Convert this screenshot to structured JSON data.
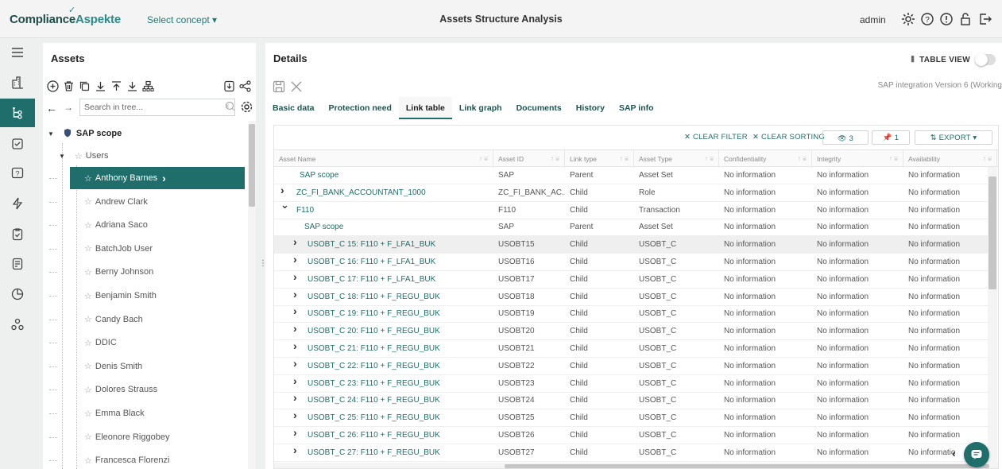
{
  "header": {
    "logo_part1": "Compliance",
    "logo_part2": "Aspekte",
    "concept_label": "Select concept ▾",
    "app_title": "Assets Structure Analysis",
    "user": "admin",
    "icons": [
      "gear-icon",
      "help-icon",
      "info-icon",
      "lock-icon",
      "logout-icon"
    ]
  },
  "leftnav": {
    "items": [
      "menu-icon",
      "building-icon",
      "tree-structure-icon",
      "checklist-icon",
      "question-icon",
      "bolt-icon",
      "clipboard-icon",
      "report-icon",
      "chart-icon",
      "org-icon"
    ],
    "active_index": 2
  },
  "assets": {
    "title": "Assets",
    "search_placeholder": "Search in tree...",
    "tree": {
      "root": "SAP scope",
      "group": "Users",
      "users": [
        "Anthony Barnes",
        "Andrew Clark",
        "Adriana Saco",
        "BatchJob User",
        "Berny Johnson",
        "Benjamin Smith",
        "Candy Bach",
        "DDIC",
        "Denis Smith",
        "Dolores Strauss",
        "Emma Black",
        "Eleonore Riggobey",
        "Francesca Florenzi"
      ],
      "selected": "Anthony Barnes"
    }
  },
  "details": {
    "title": "Details",
    "table_view_label": "TABLE VIEW",
    "version_text": "SAP integration Version 6 (Working",
    "tabs": [
      "Basic data",
      "Protection need",
      "Link table",
      "Link graph",
      "Documents",
      "History",
      "SAP info"
    ],
    "active_tab": "Link table",
    "toolbar": {
      "clear_filter": "CLEAR FILTER",
      "clear_sorting": "CLEAR SORTING",
      "visible_count": "3",
      "pinned_count": "1",
      "export": "EXPORT"
    },
    "columns": [
      "Asset Name",
      "Asset ID",
      "Link type",
      "Asset Type",
      "Confidentiality",
      "Integrity",
      "Availability"
    ],
    "rows": [
      {
        "name": "SAP scope",
        "indent": 1,
        "chev": "",
        "id": "SAP",
        "link": "Parent",
        "type": "Asset Set",
        "conf": "No information",
        "integ": "No information",
        "avail": "No information"
      },
      {
        "name": "ZC_FI_BANK_ACCOUNTANT_1000",
        "indent": 0,
        "chev": ">",
        "id": "ZC_FI_BANK_AC...",
        "link": "Child",
        "type": "Role",
        "conf": "No information",
        "integ": "No information",
        "avail": "No information"
      },
      {
        "name": "F110",
        "indent": 0,
        "chev": "v",
        "id": "F110",
        "link": "Child",
        "type": "Transaction",
        "conf": "No information",
        "integ": "No information",
        "avail": "No information"
      },
      {
        "name": "SAP scope",
        "indent": 2,
        "chev": "",
        "id": "SAP",
        "link": "Parent",
        "type": "Asset Set",
        "conf": "No information",
        "integ": "No information",
        "avail": "No information"
      },
      {
        "name": "USOBT_C 15: F110 + F_LFA1_BUK",
        "indent": 1,
        "chev": ">",
        "id": "USOBT15",
        "link": "Child",
        "type": "USOBT_C",
        "conf": "No information",
        "integ": "No information",
        "avail": "No information",
        "hl": true
      },
      {
        "name": "USOBT_C 16: F110 + F_LFA1_BUK",
        "indent": 1,
        "chev": ">",
        "id": "USOBT16",
        "link": "Child",
        "type": "USOBT_C",
        "conf": "No information",
        "integ": "No information",
        "avail": "No information"
      },
      {
        "name": "USOBT_C 17: F110 + F_LFA1_BUK",
        "indent": 1,
        "chev": ">",
        "id": "USOBT17",
        "link": "Child",
        "type": "USOBT_C",
        "conf": "No information",
        "integ": "No information",
        "avail": "No information"
      },
      {
        "name": "USOBT_C 18: F110 + F_REGU_BUK",
        "indent": 1,
        "chev": ">",
        "id": "USOBT18",
        "link": "Child",
        "type": "USOBT_C",
        "conf": "No information",
        "integ": "No information",
        "avail": "No information"
      },
      {
        "name": "USOBT_C 19: F110 + F_REGU_BUK",
        "indent": 1,
        "chev": ">",
        "id": "USOBT19",
        "link": "Child",
        "type": "USOBT_C",
        "conf": "No information",
        "integ": "No information",
        "avail": "No information"
      },
      {
        "name": "USOBT_C 20: F110 + F_REGU_BUK",
        "indent": 1,
        "chev": ">",
        "id": "USOBT20",
        "link": "Child",
        "type": "USOBT_C",
        "conf": "No information",
        "integ": "No information",
        "avail": "No information"
      },
      {
        "name": "USOBT_C 21: F110 + F_REGU_BUK",
        "indent": 1,
        "chev": ">",
        "id": "USOBT21",
        "link": "Child",
        "type": "USOBT_C",
        "conf": "No information",
        "integ": "No information",
        "avail": "No information"
      },
      {
        "name": "USOBT_C 22: F110 + F_REGU_BUK",
        "indent": 1,
        "chev": ">",
        "id": "USOBT22",
        "link": "Child",
        "type": "USOBT_C",
        "conf": "No information",
        "integ": "No information",
        "avail": "No information"
      },
      {
        "name": "USOBT_C 23: F110 + F_REGU_BUK",
        "indent": 1,
        "chev": ">",
        "id": "USOBT23",
        "link": "Child",
        "type": "USOBT_C",
        "conf": "No information",
        "integ": "No information",
        "avail": "No information"
      },
      {
        "name": "USOBT_C 24: F110 + F_REGU_BUK",
        "indent": 1,
        "chev": ">",
        "id": "USOBT24",
        "link": "Child",
        "type": "USOBT_C",
        "conf": "No information",
        "integ": "No information",
        "avail": "No information"
      },
      {
        "name": "USOBT_C 25: F110 + F_REGU_BUK",
        "indent": 1,
        "chev": ">",
        "id": "USOBT25",
        "link": "Child",
        "type": "USOBT_C",
        "conf": "No information",
        "integ": "No information",
        "avail": "No information"
      },
      {
        "name": "USOBT_C 26: F110 + F_REGU_BUK",
        "indent": 1,
        "chev": ">",
        "id": "USOBT26",
        "link": "Child",
        "type": "USOBT_C",
        "conf": "No information",
        "integ": "No information",
        "avail": "No information"
      },
      {
        "name": "USOBT_C 27: F110 + F_REGU_BUK",
        "indent": 1,
        "chev": ">",
        "id": "USOBT27",
        "link": "Child",
        "type": "USOBT_C",
        "conf": "No information",
        "integ": "No information",
        "avail": "No informatio"
      }
    ]
  },
  "colors": {
    "brand": "#1f6e6b",
    "brand_dark": "#1f4d4a",
    "accent": "#2a8a8a"
  }
}
